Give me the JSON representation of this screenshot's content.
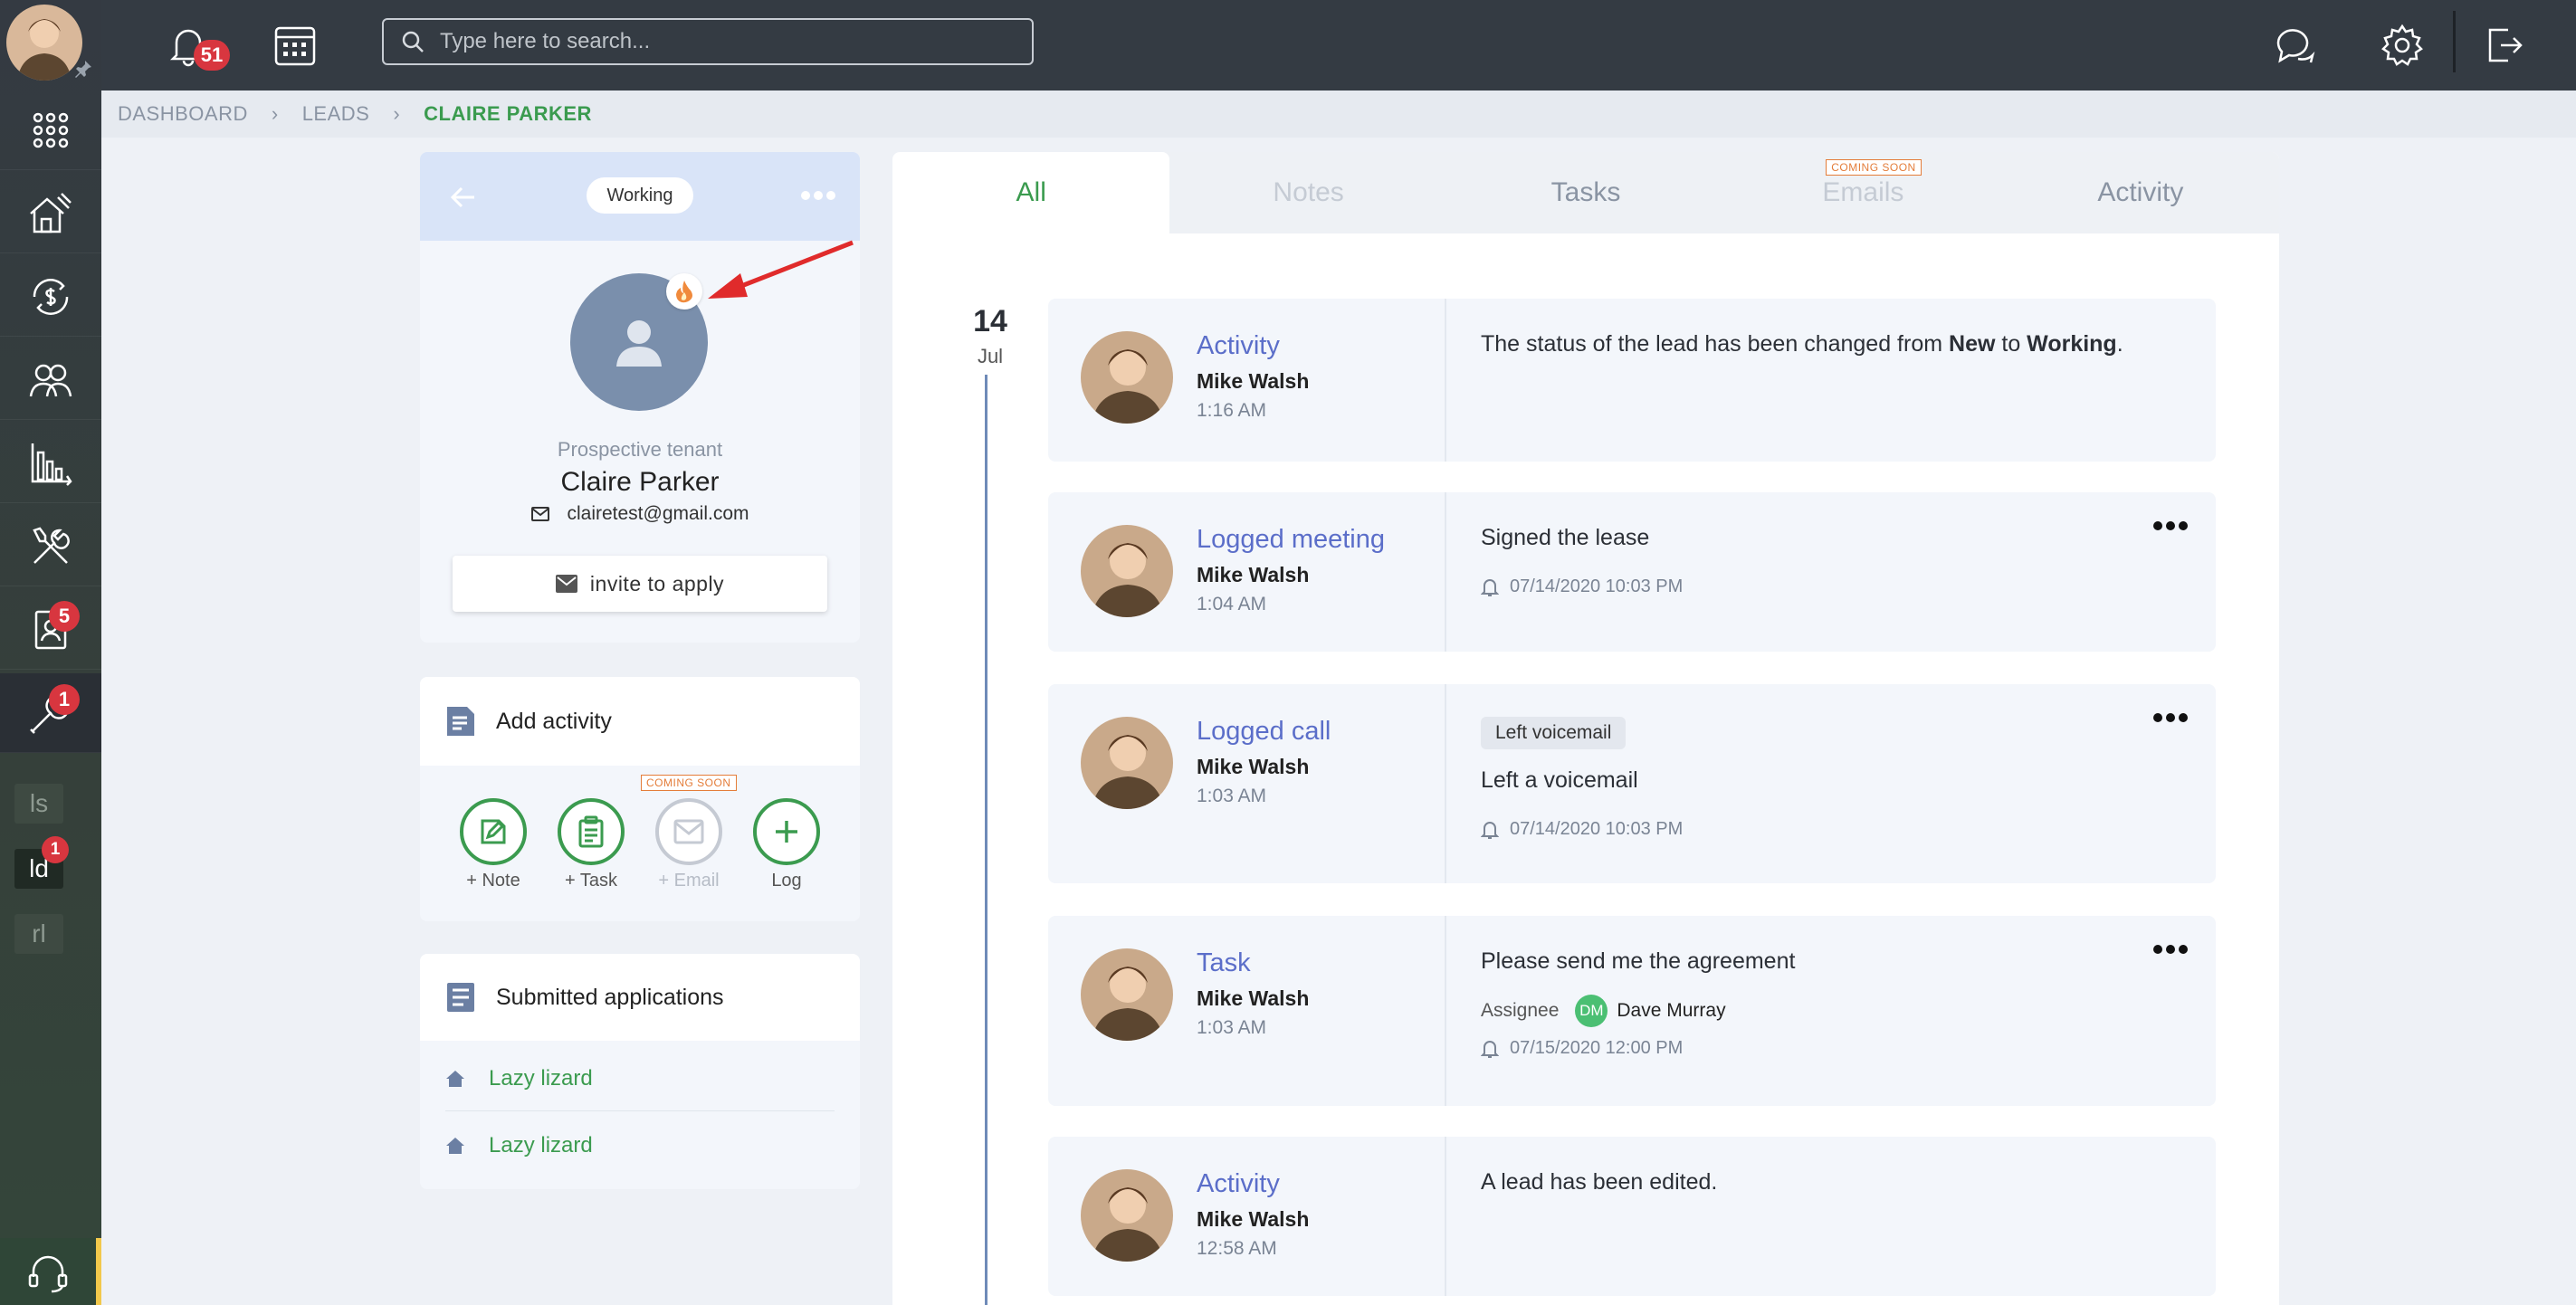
{
  "topbar": {
    "notification_count": "51",
    "search_placeholder": "Type here to search..."
  },
  "leftnav": {
    "badges": {
      "applications": "5",
      "maintenance": "1",
      "mini_ld": "1"
    },
    "mini_items": [
      "ls",
      "ld",
      "rl"
    ]
  },
  "breadcrumb": [
    "DASHBOARD",
    "LEADS",
    "CLAIRE PARKER"
  ],
  "lead": {
    "status": "Working",
    "role": "Prospective tenant",
    "name": "Claire Parker",
    "email": "clairetest@gmail.com",
    "invite_label": "invite to apply"
  },
  "add_activity": {
    "title": "Add activity",
    "coming_soon": "COMING SOON",
    "buttons": [
      {
        "label": "+ Note",
        "icon": "note-icon"
      },
      {
        "label": "+ Task",
        "icon": "task-icon"
      },
      {
        "label": "+ Email",
        "icon": "email-icon",
        "disabled": true
      },
      {
        "label": "Log",
        "icon": "plus-icon"
      }
    ]
  },
  "submitted_applications": {
    "title": "Submitted applications",
    "items": [
      "Lazy lizard",
      "Lazy lizard"
    ]
  },
  "tabs": [
    {
      "label": "All",
      "active": true
    },
    {
      "label": "Notes",
      "disabled": true
    },
    {
      "label": "Tasks"
    },
    {
      "label": "Emails",
      "disabled": true,
      "badge": "COMING SOON"
    },
    {
      "label": "Activity"
    }
  ],
  "timeline": {
    "day": "14",
    "month": "Jul",
    "entries": [
      {
        "type": "Activity",
        "by": "Mike Walsh",
        "time": "1:16 AM",
        "text_pre": "The status of the lead has been changed from ",
        "from": "New",
        "mid": " to ",
        "to": "Working",
        "post": "."
      },
      {
        "type": "Logged meeting",
        "by": "Mike Walsh",
        "time": "1:04 AM",
        "text": "Signed the lease",
        "reminder": "07/14/2020 10:03 PM"
      },
      {
        "type": "Logged call",
        "by": "Mike Walsh",
        "time": "1:03 AM",
        "tag": "Left voicemail",
        "text": "Left a voicemail",
        "reminder": "07/14/2020 10:03 PM"
      },
      {
        "type": "Task",
        "by": "Mike Walsh",
        "time": "1:03 AM",
        "text": "Please send me the agreement",
        "assignee_label": "Assignee",
        "assignee_initials": "DM",
        "assignee": "Dave Murray",
        "reminder": "07/15/2020 12:00 PM"
      },
      {
        "type": "Activity",
        "by": "Mike Walsh",
        "time": "12:58 AM",
        "text": "A lead has been edited."
      }
    ]
  },
  "colors": {
    "accent": "#3b9b4f",
    "link": "#5b6ec9",
    "badge": "#d8363f",
    "topbar": "#343b43"
  }
}
